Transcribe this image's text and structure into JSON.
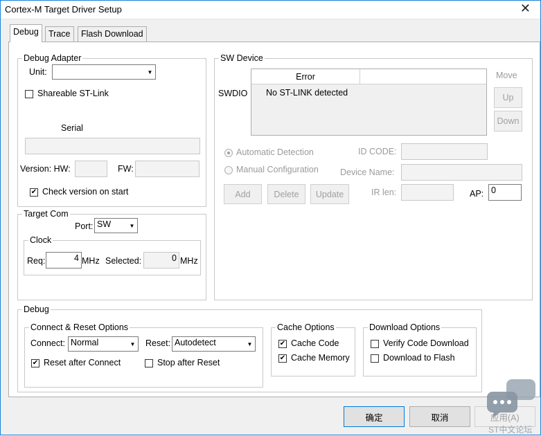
{
  "window": {
    "title": "Cortex-M Target Driver Setup",
    "close_glyph": "✕"
  },
  "tabs": [
    {
      "label": "Debug",
      "active": true
    },
    {
      "label": "Trace",
      "active": false
    },
    {
      "label": "Flash Download",
      "active": false
    }
  ],
  "debug_adapter": {
    "legend": "Debug Adapter",
    "unit_label": "Unit:",
    "unit_value": "",
    "shareable_label": "Shareable ST-Link",
    "shareable_checked": false,
    "serial_label": "Serial",
    "serial_value": "",
    "version_hw_label": "Version: HW:",
    "hw_value": "",
    "fw_label": "FW:",
    "fw_value": "",
    "check_version_label": "Check version on start",
    "check_version_checked": true
  },
  "sw_device": {
    "legend": "SW Device",
    "swdio_label": "SWDIO",
    "columns": [
      "Error",
      ""
    ],
    "rows": [
      {
        "text": "No ST-LINK detected"
      }
    ],
    "move_label": "Move",
    "up_label": "Up",
    "down_label": "Down",
    "auto_detect_label": "Automatic Detection",
    "manual_config_label": "Manual Configuration",
    "id_code_label": "ID CODE:",
    "device_name_label": "Device Name:",
    "ir_len_label": "IR len:",
    "ap_label": "AP:",
    "ap_value": "0",
    "add_label": "Add",
    "delete_label": "Delete",
    "update_label": "Update"
  },
  "target_com": {
    "legend": "Target Com",
    "port_label": "Port:",
    "port_value": "SW",
    "clock_legend": "Clock",
    "req_label": "Req:",
    "req_value": "4",
    "mhz_label": "MHz",
    "selected_label": "Selected:",
    "selected_value": "0",
    "mhz2_label": "MHz"
  },
  "debug": {
    "legend": "Debug",
    "connect_reset": {
      "legend": "Connect & Reset Options",
      "connect_label": "Connect:",
      "connect_value": "Normal",
      "reset_label": "Reset:",
      "reset_value": "Autodetect",
      "reset_after_connect_label": "Reset after Connect",
      "reset_after_connect_checked": true,
      "stop_after_reset_label": "Stop after Reset",
      "stop_after_reset_checked": false
    },
    "cache": {
      "legend": "Cache Options",
      "cache_code_label": "Cache Code",
      "cache_code_checked": true,
      "cache_memory_label": "Cache Memory",
      "cache_memory_checked": true
    },
    "download": {
      "legend": "Download Options",
      "verify_label": "Verify Code Download",
      "verify_checked": false,
      "flash_label": "Download to Flash",
      "flash_checked": false
    }
  },
  "footer": {
    "ok_label": "确定",
    "cancel_label": "取消",
    "apply_label": "应用(A)",
    "watermark": "ST中文论坛"
  }
}
